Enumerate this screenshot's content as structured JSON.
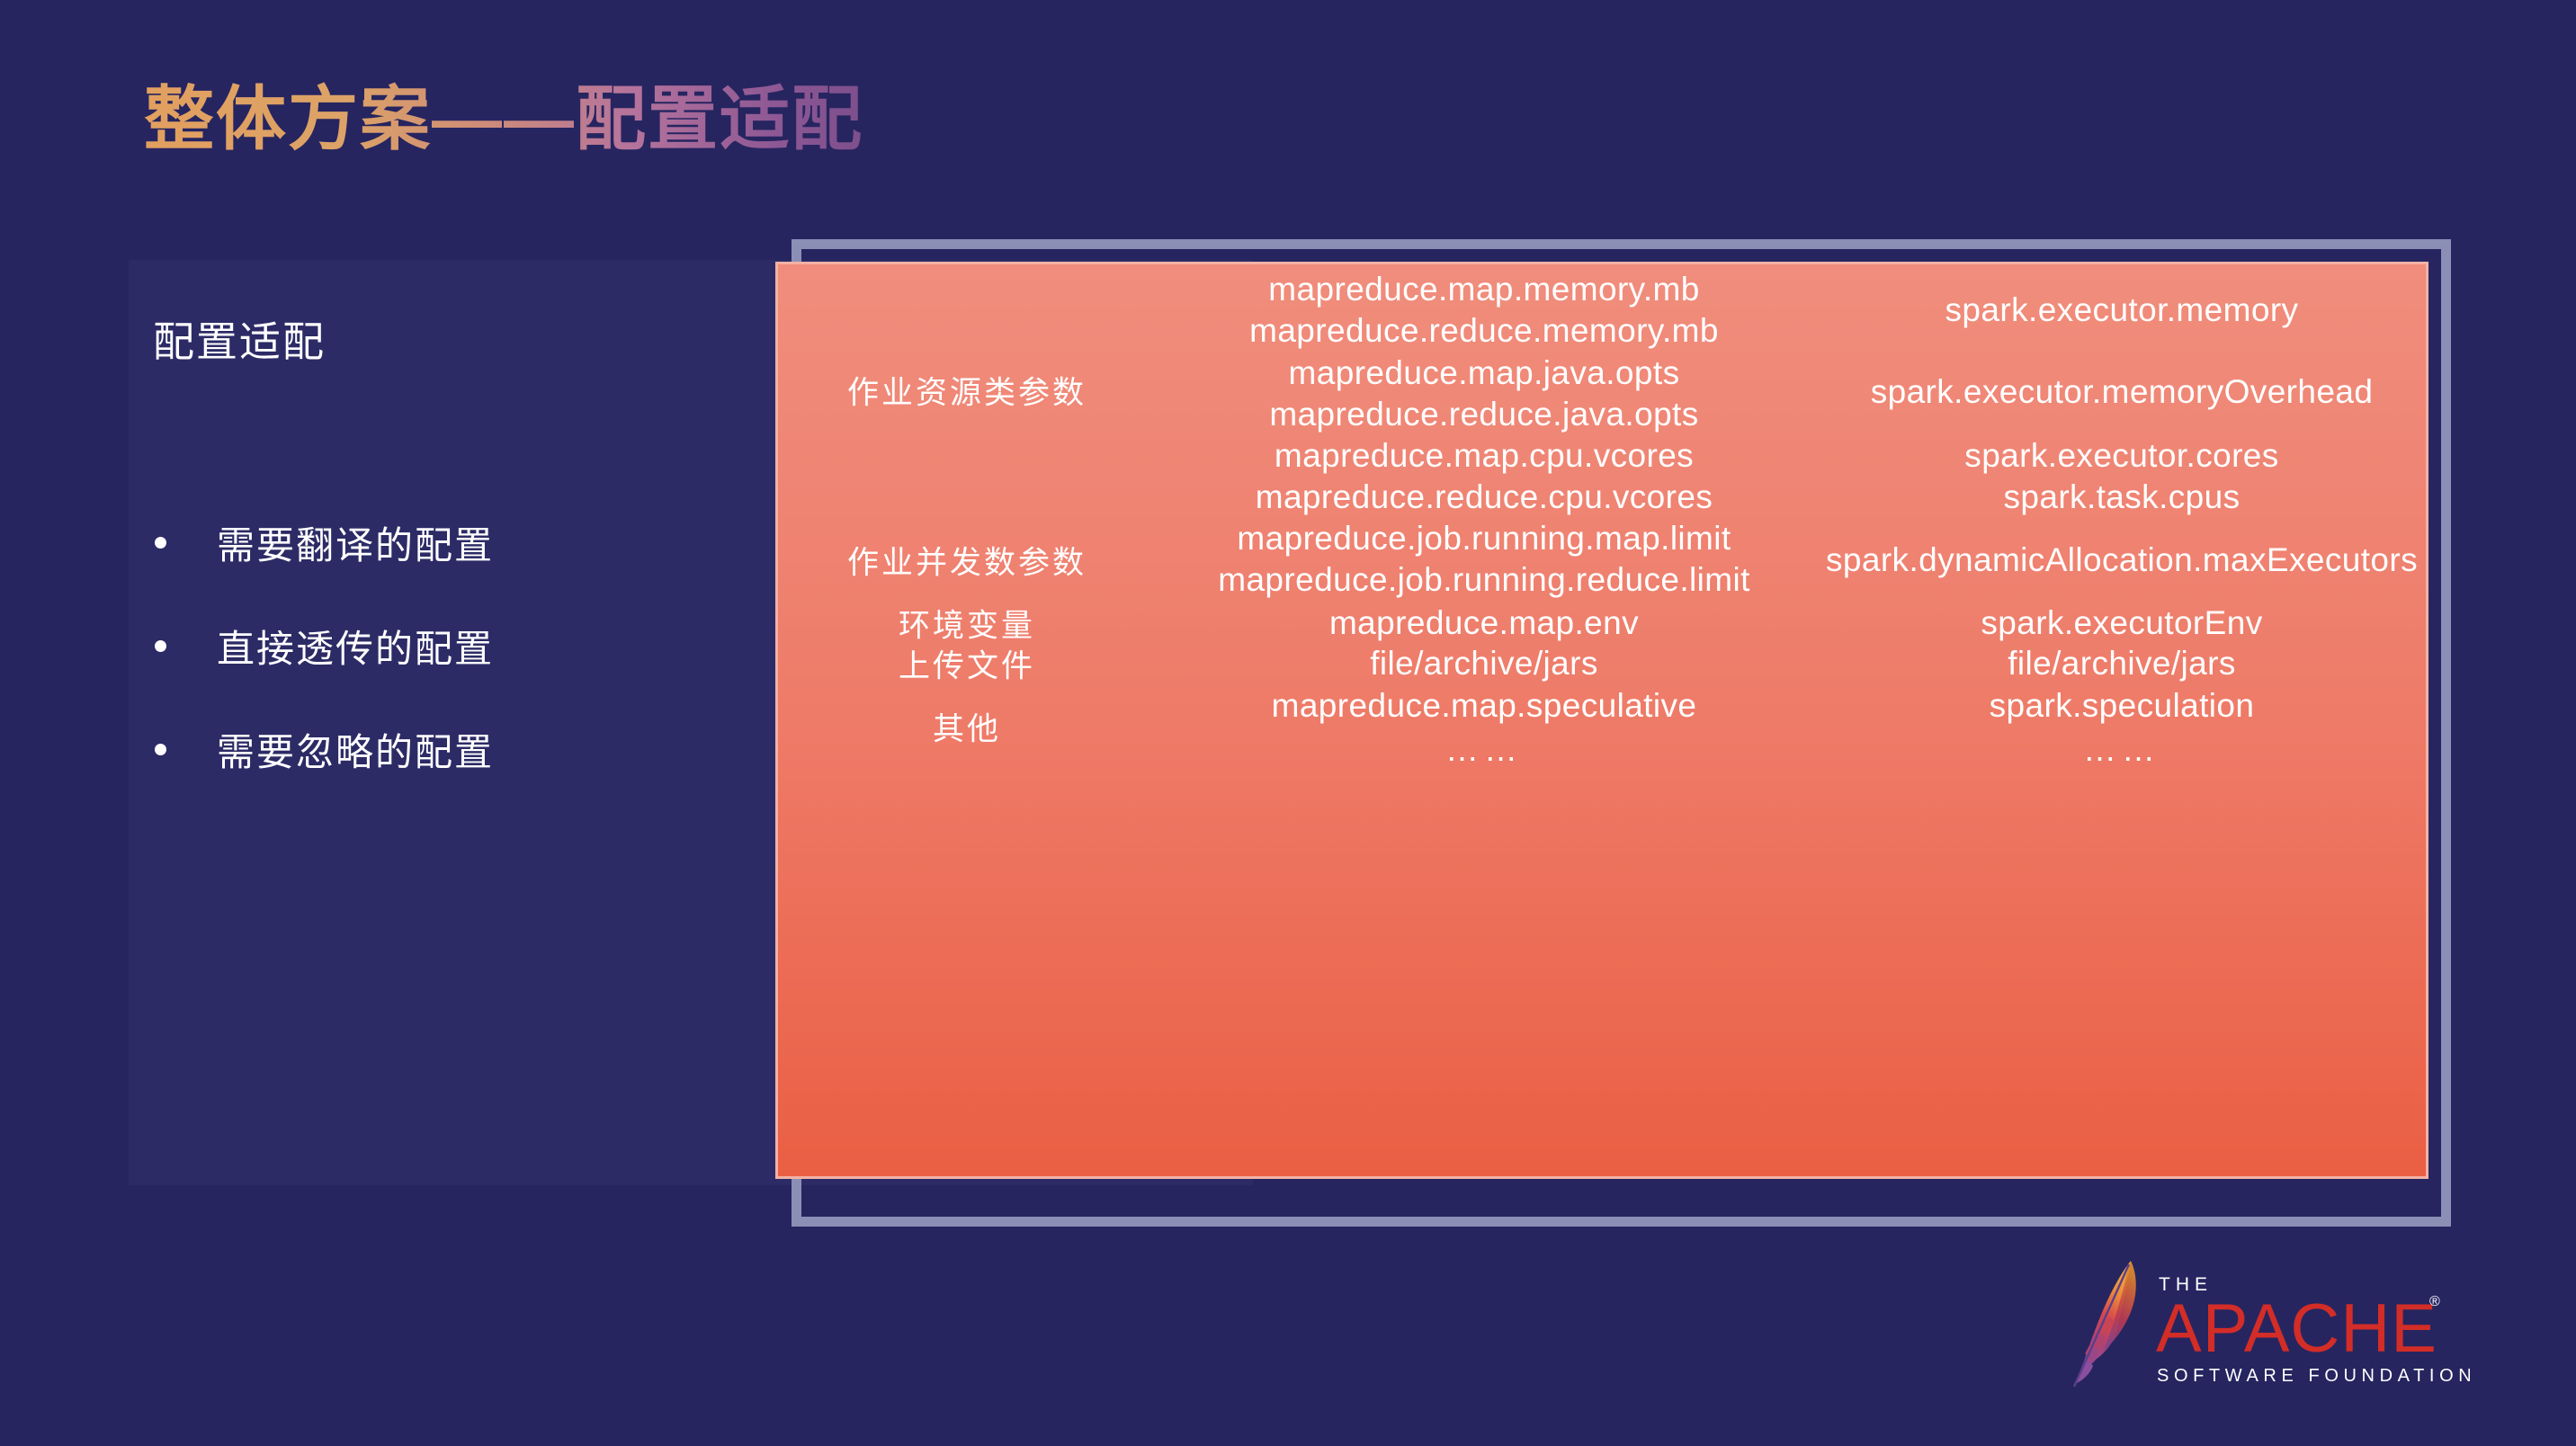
{
  "slide": {
    "title": "整体方案——配置适配",
    "background_color": "#262560",
    "title_gradient_from": "#e2a05f",
    "title_gradient_to": "#7d4f8c"
  },
  "left": {
    "heading": "配置适配",
    "bullets": [
      "需要翻译的配置",
      "直接透传的配置",
      "需要忽略的配置"
    ]
  },
  "table": {
    "panel_gradient_from": "#f08d7c",
    "panel_gradient_to": "#ea5f44",
    "border_color": "#f2b2a6",
    "frame_color": "#8b8fb5",
    "rows": [
      {
        "label": "作业资源类参数",
        "mapreduce": [
          "mapreduce.map.memory.mb",
          "mapreduce.reduce.memory.mb",
          "mapreduce.map.java.opts",
          "mapreduce.reduce.java.opts",
          "mapreduce.map.cpu.vcores",
          "mapreduce.reduce.cpu.vcores"
        ],
        "spark": [
          "spark.executor.memory",
          "spark.executor.memoryOverhead",
          "spark.executor.cores",
          "spark.task.cpus"
        ]
      },
      {
        "label": "作业并发数参数",
        "mapreduce": [
          "mapreduce.job.running.map.limit",
          "mapreduce.job.running.reduce.limit"
        ],
        "spark": [
          "spark.dynamicAllocation.maxExecutors"
        ]
      },
      {
        "label": "环境变量",
        "mapreduce": [
          "mapreduce.map.env"
        ],
        "spark": [
          "spark.executorEnv"
        ]
      },
      {
        "label": "上传文件",
        "mapreduce": [
          "file/archive/jars"
        ],
        "spark": [
          "file/archive/jars"
        ]
      },
      {
        "label": "其他",
        "mapreduce": [
          "mapreduce.map.speculative",
          "……"
        ],
        "spark": [
          "spark.speculation",
          "……"
        ]
      }
    ],
    "cells": {
      "label_r1": "作业资源类参数",
      "label_r2": "作业并发数参数",
      "label_r3": "环境变量",
      "label_r4": "上传文件",
      "label_r5": "其他",
      "mr_1": "mapreduce.map.memory.mb",
      "mr_2": "mapreduce.reduce.memory.mb",
      "mr_3": "mapreduce.map.java.opts",
      "mr_4": "mapreduce.reduce.java.opts",
      "mr_5": "mapreduce.map.cpu.vcores",
      "mr_6": "mapreduce.reduce.cpu.vcores",
      "mr_7": "mapreduce.job.running.map.limit",
      "mr_8": "mapreduce.job.running.reduce.limit",
      "mr_9": "mapreduce.map.env",
      "mr_10": "file/archive/jars",
      "mr_11": "mapreduce.map.speculative",
      "mr_12": "……",
      "sp_1": "spark.executor.memory",
      "sp_2": "spark.executor.memoryOverhead",
      "sp_3": "spark.executor.cores",
      "sp_4": "spark.task.cpus",
      "sp_5": "spark.dynamicAllocation.maxExecutors",
      "sp_6": "spark.executorEnv",
      "sp_7": "file/archive/jars",
      "sp_8": "spark.speculation",
      "sp_9": "……"
    }
  },
  "logo": {
    "line_the": "THE",
    "line_apache": "APACHE",
    "registered_mark": "®",
    "line_foundation": "SOFTWARE FOUNDATION",
    "feather_top_color": "#f0a030",
    "feather_mid_color": "#d14445",
    "feather_bottom_color": "#8a4f9e",
    "wordmark_color": "#d32d27"
  }
}
